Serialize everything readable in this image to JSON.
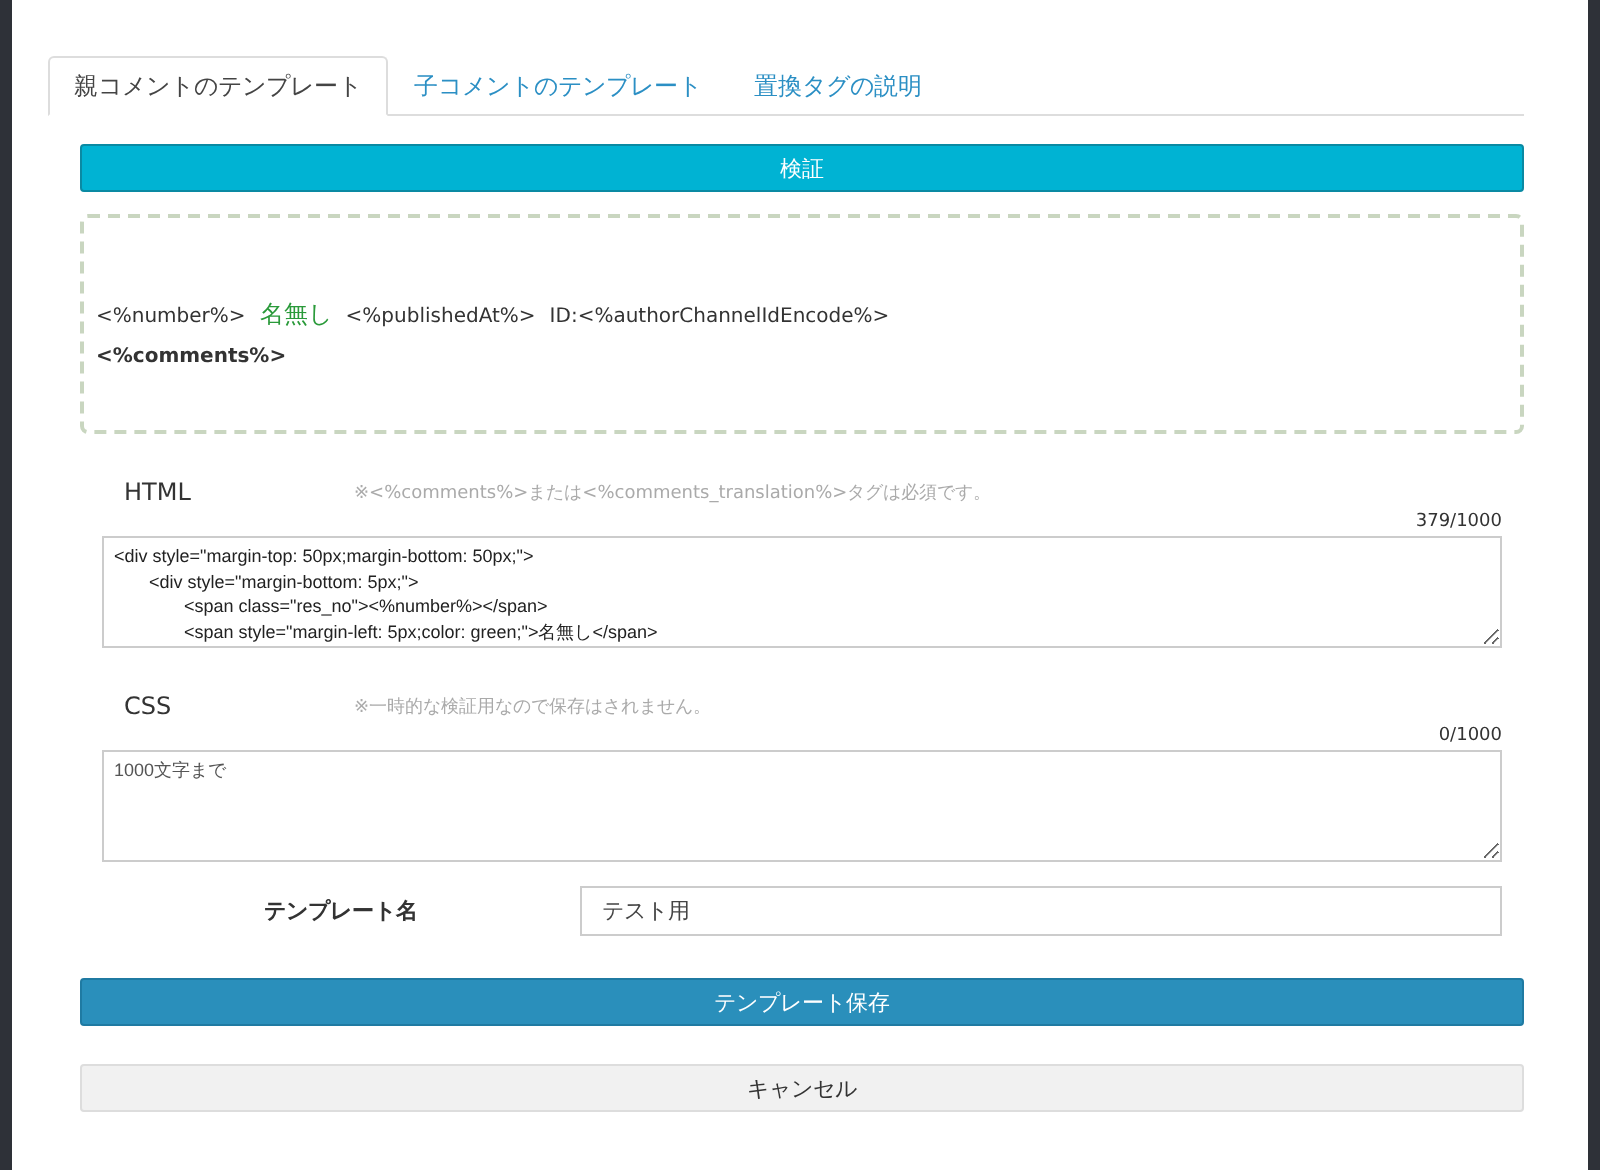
{
  "tabs": [
    {
      "label": "親コメントのテンプレート",
      "selected": true
    },
    {
      "label": "子コメントのテンプレート",
      "selected": false
    },
    {
      "label": "置換タグの説明",
      "selected": false
    }
  ],
  "verify_button": "検証",
  "preview": {
    "header_parts": [
      {
        "kind": "plain",
        "text": "<%number%>"
      },
      {
        "kind": "name",
        "text": "名無し"
      },
      {
        "kind": "plain",
        "text": "<%publishedAt%>"
      },
      {
        "kind": "plain",
        "text": "ID:<%authorChannelIdEncode%>"
      }
    ],
    "body": "<%comments%>"
  },
  "sections": [
    {
      "label": "HTML",
      "note": "※<%comments%>または<%comments_translation%>タグは必須です。",
      "counter": "379/1000",
      "value": "<div style=\"margin-top: 50px;margin-bottom: 50px;\">\n\t<div style=\"margin-bottom: 5px;\">\n\t\t<span class=\"res_no\"><%number%></span>\n\t\t<span style=\"margin-left: 5px;color: green;\">名無し</span>"
    },
    {
      "label": "CSS",
      "note": "※一時的な検証用なので保存はされません。",
      "counter": "0/1000",
      "placeholder": "1000文字まで"
    }
  ],
  "template_name": {
    "label": "テンプレート名",
    "value": "テスト用"
  },
  "save_button": "テンプレート保存",
  "cancel_button": "キャンセル"
}
